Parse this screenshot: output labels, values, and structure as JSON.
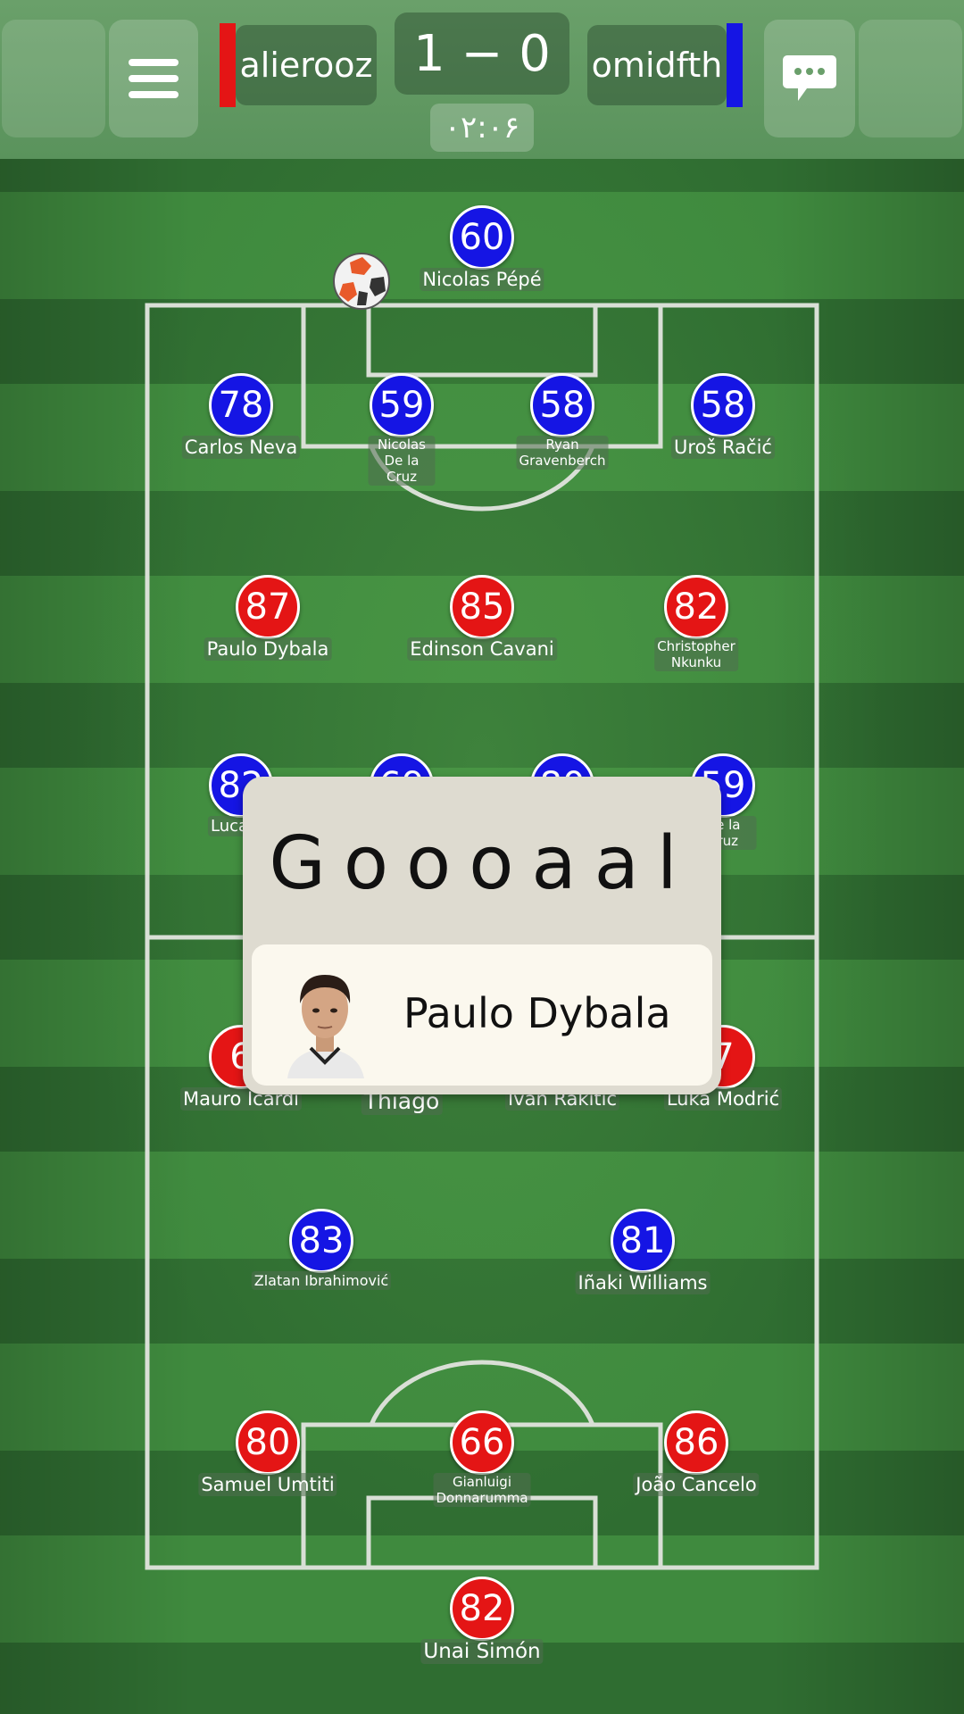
{
  "header": {
    "home_player": "alierooz",
    "away_player": "omidfth",
    "score": "1 − 0",
    "timer": "۰۲:۰۶",
    "home_color": "#e41515",
    "away_color": "#1515e4",
    "menu_icon": "hamburger-menu-icon",
    "chat_icon": "chat-bubble-icon"
  },
  "players": [
    {
      "rating": "60",
      "name": "Nicolas Pépé",
      "team": "blue"
    },
    {
      "rating": "78",
      "name": "Carlos Neva",
      "team": "blue"
    },
    {
      "rating": "59",
      "name": "Nicolas De la Cruz",
      "team": "blue"
    },
    {
      "rating": "58",
      "name": "Ryan Gravenberch",
      "team": "blue"
    },
    {
      "rating": "58",
      "name": "Uroš Račić",
      "team": "blue"
    },
    {
      "rating": "87",
      "name": "Paulo Dybala",
      "team": "red"
    },
    {
      "rating": "85",
      "name": "Edinson Cavani",
      "team": "red"
    },
    {
      "rating": "82",
      "name": "Christopher Nkunku",
      "team": "red"
    },
    {
      "rating": "82",
      "name": "Lucas P",
      "team": "blue"
    },
    {
      "rating": "69",
      "name": "",
      "team": "blue"
    },
    {
      "rating": "80",
      "name": "",
      "team": "blue"
    },
    {
      "rating": "59",
      "name": "De la Cruz",
      "team": "blue"
    },
    {
      "rating": "6",
      "name": "Mauro Icardi",
      "team": "red"
    },
    {
      "rating": "",
      "name": "Thiago",
      "team": "red"
    },
    {
      "rating": "",
      "name": "Ivan Rakitić",
      "team": "red"
    },
    {
      "rating": "7",
      "name": "Luka Modrić",
      "team": "red"
    },
    {
      "rating": "83",
      "name": "Zlatan Ibrahimović",
      "team": "blue"
    },
    {
      "rating": "81",
      "name": "Iñaki Williams",
      "team": "blue"
    },
    {
      "rating": "80",
      "name": "Samuel Umtiti",
      "team": "red"
    },
    {
      "rating": "66",
      "name": "Gianluigi Donnarumma",
      "team": "red"
    },
    {
      "rating": "86",
      "name": "João Cancelo",
      "team": "red"
    },
    {
      "rating": "82",
      "name": "Unai Simón",
      "team": "red"
    }
  ],
  "goal_popup": {
    "title": "Goooaal",
    "scorer": "Paulo Dybala"
  }
}
